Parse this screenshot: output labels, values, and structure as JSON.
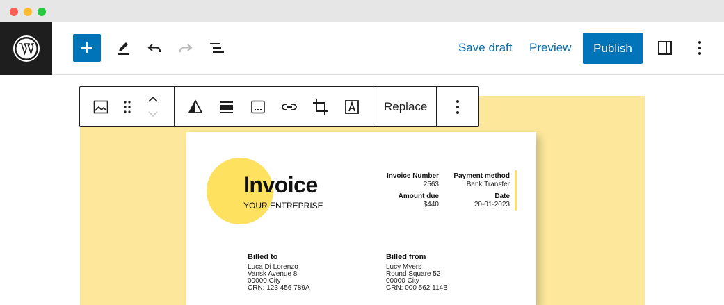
{
  "header": {
    "save_draft": "Save draft",
    "preview": "Preview",
    "publish": "Publish"
  },
  "block_toolbar": {
    "replace": "Replace"
  },
  "invoice": {
    "title": "Invoice",
    "subtitle": "YOUR ENTREPRISE",
    "invoice_number_label": "Invoice Number",
    "invoice_number": "2563",
    "payment_method_label": "Payment method",
    "payment_method": "Bank Transfer",
    "amount_due_label": "Amount due",
    "amount_due": "$440",
    "date_label": "Date",
    "date": "20-01-2023",
    "billed_to": {
      "heading": "Billed to",
      "lines": [
        "Luca Di Lorenzo",
        "Vansk Avenue 8",
        "00000 City",
        "CRN: 123 456 789A"
      ]
    },
    "billed_from": {
      "heading": "Billed from",
      "lines": [
        "Lucy Myers",
        "Round Square 52",
        "00000 City",
        "CRN: 000 562 114B"
      ]
    }
  },
  "colors": {
    "accent_blue": "#0074b8",
    "cover_yellow": "#fce79a",
    "circle_yellow": "#fde15f",
    "dark": "#1e1e1e"
  },
  "icons": [
    "wordpress-logo-icon",
    "plus-icon",
    "pencil-icon",
    "undo-icon",
    "redo-icon",
    "list-view-icon",
    "sidebar-icon",
    "more-vertical-icon",
    "image-icon",
    "drag-handle-icon",
    "chevron-up-icon",
    "chevron-down-icon",
    "duotone-icon",
    "align-icon",
    "caption-icon",
    "link-icon",
    "crop-icon",
    "text-overlay-icon"
  ]
}
